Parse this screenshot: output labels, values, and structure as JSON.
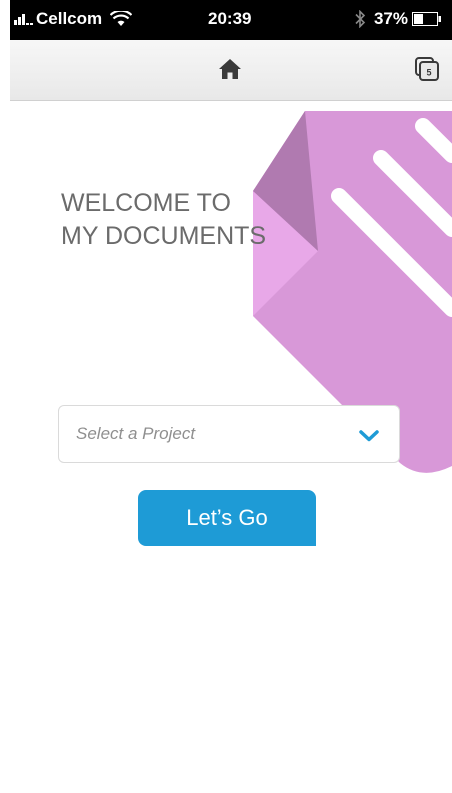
{
  "status_bar": {
    "carrier": "Cellcom",
    "time": "20:39",
    "battery": "37%"
  },
  "nav": {
    "tab_count": "5"
  },
  "welcome": {
    "title": "WELCOME TO\nMY DOCUMENTS"
  },
  "project_select": {
    "placeholder": "Select a Project"
  },
  "go_button": {
    "label": "Let’s Go"
  },
  "colors": {
    "accent": "#1e9bd6",
    "decor_pink": "#d898d8",
    "decor_dark": "#b07ab0",
    "decor_light": "#e8a8e8"
  }
}
